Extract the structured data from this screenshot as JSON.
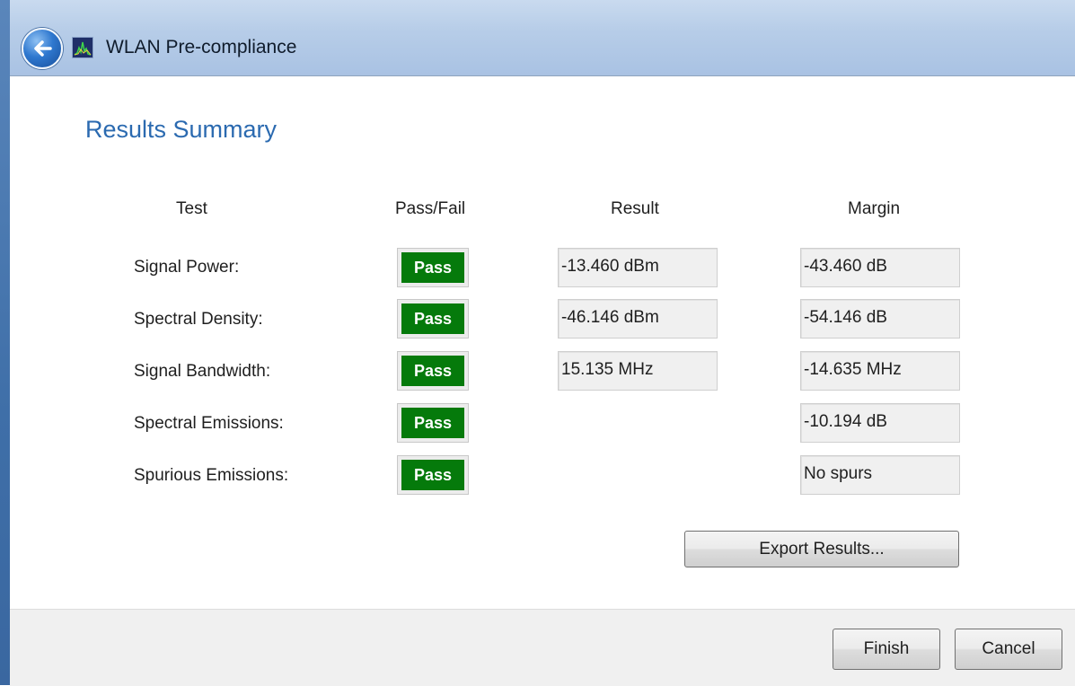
{
  "window": {
    "title": "WLAN Pre-compliance",
    "back_icon": "back-arrow-icon",
    "app_icon": "spectrum-app-icon"
  },
  "page": {
    "title": "Results Summary"
  },
  "table": {
    "headers": {
      "test": "Test",
      "pass_fail": "Pass/Fail",
      "result": "Result",
      "margin": "Margin"
    },
    "rows": [
      {
        "test": "Signal Power:",
        "status": "Pass",
        "result": "-13.460 dBm",
        "margin": "-43.460 dB"
      },
      {
        "test": "Spectral Density:",
        "status": "Pass",
        "result": "-46.146 dBm",
        "margin": "-54.146 dB"
      },
      {
        "test": "Signal Bandwidth:",
        "status": "Pass",
        "result": "15.135 MHz",
        "margin": "-14.635 MHz"
      },
      {
        "test": "Spectral Emissions:",
        "status": "Pass",
        "result": "",
        "margin": "-10.194 dB"
      },
      {
        "test": "Spurious Emissions:",
        "status": "Pass",
        "result": "",
        "margin": "No spurs"
      }
    ]
  },
  "buttons": {
    "export": "Export Results...",
    "finish": "Finish",
    "cancel": "Cancel"
  },
  "colors": {
    "pass": "#057a0b",
    "title_accent": "#2b6ab0",
    "title_bar": "#b7cde8"
  }
}
